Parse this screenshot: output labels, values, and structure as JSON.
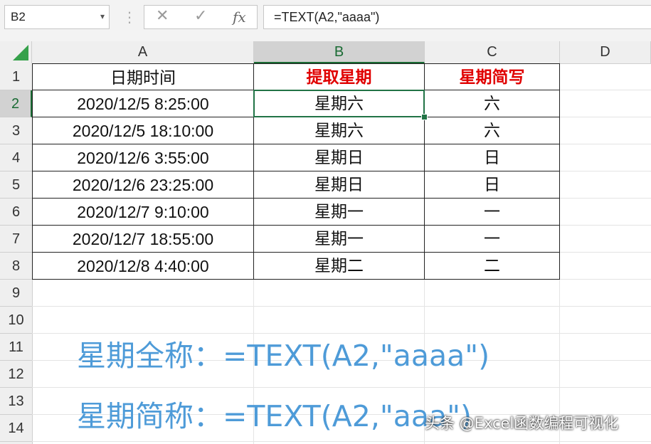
{
  "formula_bar": {
    "name_box": "B2",
    "cancel_icon": "cancel-icon",
    "enter_icon": "check-icon",
    "fx_label": "fx",
    "formula": "=TEXT(A2,\"aaaa\")"
  },
  "columns": [
    "A",
    "B",
    "C",
    "D"
  ],
  "rows": [
    "1",
    "2",
    "3",
    "4",
    "5",
    "6",
    "7",
    "8",
    "9",
    "10",
    "11",
    "12",
    "13",
    "14"
  ],
  "table": {
    "headers": [
      "日期时间",
      "提取星期",
      "星期简写"
    ],
    "data": [
      [
        "2020/12/5 8:25:00",
        "星期六",
        "六"
      ],
      [
        "2020/12/5 18:10:00",
        "星期六",
        "六"
      ],
      [
        "2020/12/6 3:55:00",
        "星期日",
        "日"
      ],
      [
        "2020/12/6 23:25:00",
        "星期日",
        "日"
      ],
      [
        "2020/12/7 9:10:00",
        "星期一",
        "一"
      ],
      [
        "2020/12/7 18:55:00",
        "星期一",
        "一"
      ],
      [
        "2020/12/8 4:40:00",
        "星期二",
        "二"
      ]
    ]
  },
  "notes": {
    "full": "星期全称：=TEXT(A2,\"aaaa\")",
    "short": "星期简称：=TEXT(A2,\"aaa\")"
  },
  "watermark": "头条 @Excel函数编程可视化",
  "colors": {
    "accent_green": "#217346",
    "header_red": "#e00000",
    "note_blue": "#4e9bd8"
  }
}
